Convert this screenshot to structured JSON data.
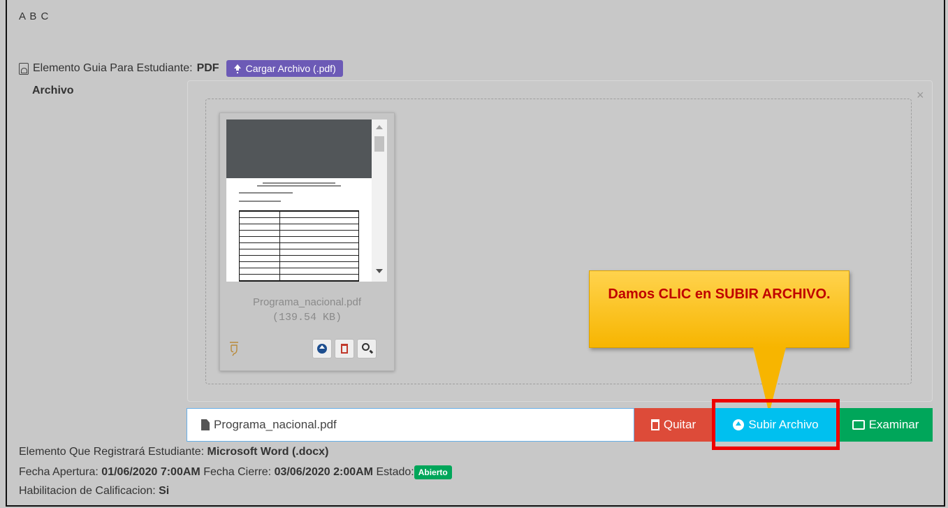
{
  "header": {
    "letters": "A B C"
  },
  "guide": {
    "label": "Elemento Guia Para Estudiante:",
    "format": "PDF",
    "upload_button": "Cargar Archivo (.pdf)"
  },
  "archivo_label": "Archivo",
  "preview": {
    "close_symbol": "×",
    "file_name": "Programa_nacional.pdf",
    "file_size": "(139.54 KB)"
  },
  "callout": {
    "text": "Damos CLIC en SUBIR ARCHIVO."
  },
  "file_input": {
    "value": "Programa_nacional.pdf",
    "remove_label": "Quitar",
    "upload_label": "Subir Archivo",
    "browse_label": "Examinar"
  },
  "info": {
    "register_label": "Elemento Que Registrará Estudiante:",
    "register_value": "Microsoft Word (.docx)",
    "open_label": "Fecha Apertura:",
    "open_value": "01/06/2020 7:00AM",
    "close_label": "Fecha Cierre:",
    "close_value": "03/06/2020 2:00AM",
    "state_label": "Estado:",
    "state_value": "Abierto",
    "grading_label": "Habilitacion de Calificacion:",
    "grading_value": "Si"
  },
  "colors": {
    "upload_main": "#6c5ab6",
    "remove": "#dd4b39",
    "upload": "#00c0ef",
    "browse": "#00a65a",
    "highlight": "#ee0000",
    "callout_text": "#c00000"
  }
}
